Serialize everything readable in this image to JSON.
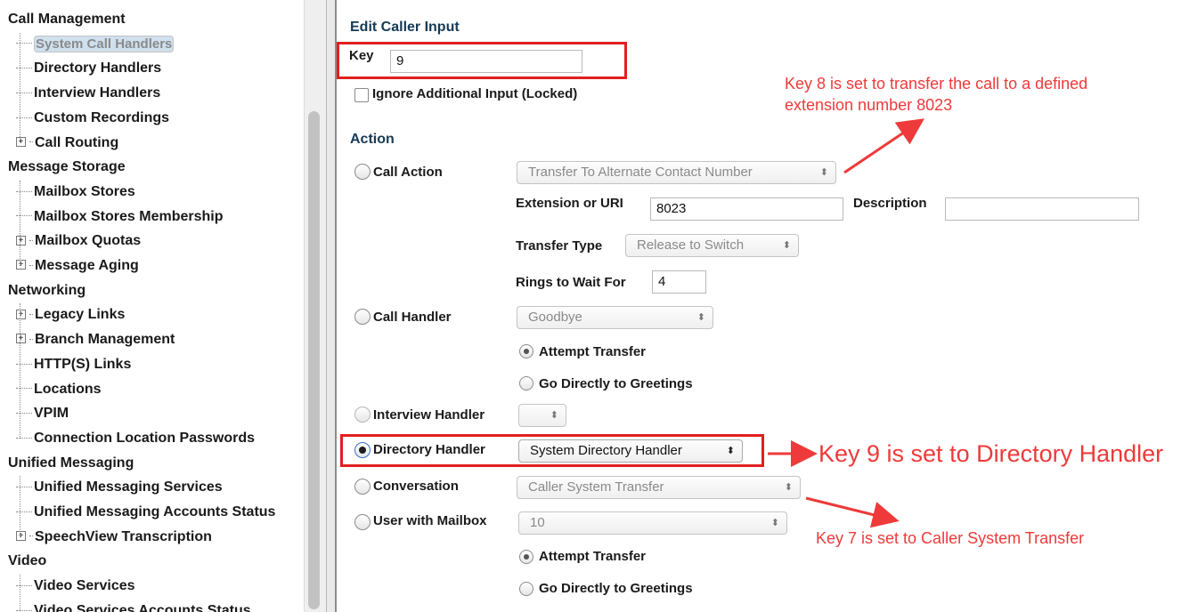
{
  "tree": {
    "items": [
      {
        "label": "Call Management",
        "type": "cat"
      },
      {
        "label": "System Call Handlers",
        "type": "leaf",
        "selected": true
      },
      {
        "label": "Directory Handlers",
        "type": "leaf"
      },
      {
        "label": "Interview Handlers",
        "type": "leaf"
      },
      {
        "label": "Custom Recordings",
        "type": "leaf"
      },
      {
        "label": "Call Routing",
        "type": "expand"
      },
      {
        "label": "Message Storage",
        "type": "cat"
      },
      {
        "label": "Mailbox Stores",
        "type": "leaf"
      },
      {
        "label": "Mailbox Stores Membership",
        "type": "leaf"
      },
      {
        "label": "Mailbox Quotas",
        "type": "expand"
      },
      {
        "label": "Message Aging",
        "type": "expand"
      },
      {
        "label": "Networking",
        "type": "cat"
      },
      {
        "label": "Legacy Links",
        "type": "expand"
      },
      {
        "label": "Branch Management",
        "type": "expand"
      },
      {
        "label": "HTTP(S) Links",
        "type": "leaf"
      },
      {
        "label": "Locations",
        "type": "leaf"
      },
      {
        "label": "VPIM",
        "type": "leaf"
      },
      {
        "label": "Connection Location Passwords",
        "type": "leaf"
      },
      {
        "label": "Unified Messaging",
        "type": "cat"
      },
      {
        "label": "Unified Messaging Services",
        "type": "leaf"
      },
      {
        "label": "Unified Messaging Accounts Status",
        "type": "leaf"
      },
      {
        "label": "SpeechView Transcription",
        "type": "expand"
      },
      {
        "label": "Video",
        "type": "cat"
      },
      {
        "label": "Video Services",
        "type": "leaf"
      },
      {
        "label": "Video Services Accounts Status",
        "type": "leaf"
      }
    ]
  },
  "form": {
    "title": "Edit Caller Input",
    "key_label": "Key",
    "key_value": "9",
    "ignore_label": "Ignore Additional Input (Locked)",
    "action_title": "Action",
    "call_action_label": "Call Action",
    "call_action_value": "Transfer To Alternate Contact Number",
    "ext_label": "Extension or URI",
    "ext_value": "8023",
    "desc_label": "Description",
    "desc_value": "",
    "transfer_type_label": "Transfer Type",
    "transfer_type_value": "Release to Switch",
    "rings_label": "Rings to Wait For",
    "rings_value": "4",
    "call_handler_label": "Call Handler",
    "call_handler_value": "Goodbye",
    "attempt_transfer_label": "Attempt Transfer",
    "go_directly_label": "Go Directly to Greetings",
    "interview_handler_label": "Interview Handler",
    "interview_handler_value": "",
    "directory_handler_label": "Directory Handler",
    "directory_handler_value": "System Directory Handler",
    "conversation_label": "Conversation",
    "conversation_value": "Caller System Transfer",
    "user_mailbox_label": "User with Mailbox",
    "user_mailbox_value": "10",
    "attempt_transfer2_label": "Attempt Transfer",
    "go_directly2_label": "Go Directly to Greetings"
  },
  "annotations": {
    "note1_line1": "Key 8 is set to transfer the call to a defined",
    "note1_line2": "extension number 8023",
    "note2": "Key 9 is set to Directory Handler",
    "note3": "Key 7 is set to Caller System Transfer",
    "color": "#ee3a3a"
  }
}
